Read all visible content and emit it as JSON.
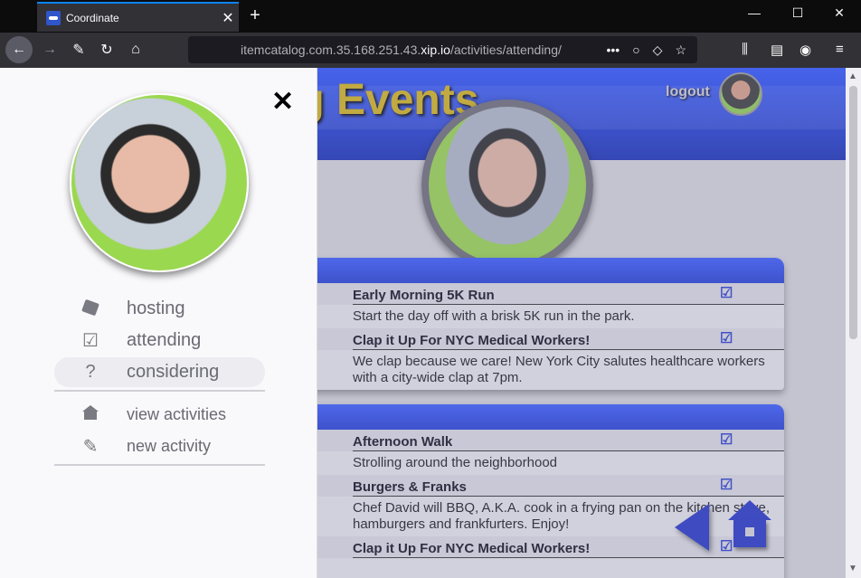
{
  "browser": {
    "tab_title": "Coordinate",
    "tab_close": "✕",
    "new_tab": "+",
    "url_host": "itemcatalog.com.35.168.251.43.",
    "url_domain": "xip.io",
    "url_path": "/activities/attending/",
    "window_controls": [
      "—",
      "☐",
      "✕"
    ]
  },
  "page": {
    "title": "ng Events",
    "logout_label": "logout"
  },
  "cards": [
    {
      "events": [
        {
          "title": "Early Morning 5K Run",
          "description": "Start the day off with a brisk 5K run in the park."
        },
        {
          "title": "Clap it Up For NYC Medical Workers!",
          "description": "We clap because we care! New York City salutes healthcare workers with a city-wide clap at 7pm."
        }
      ]
    },
    {
      "events": [
        {
          "title": "Afternoon Walk",
          "description": "Strolling around the neighborhood"
        },
        {
          "title": "Burgers & Franks",
          "description": "Chef David will BBQ, A.K.A. cook in a frying pan on the kitchen stove, hamburgers and frankfurters. Enjoy!"
        },
        {
          "title": "Clap it Up For NYC Medical Workers!",
          "description": ""
        }
      ]
    }
  ],
  "check_glyph": "☑",
  "sidebar": {
    "close_label": "✕",
    "items": [
      {
        "label": "hosting",
        "icon": "tag-icon"
      },
      {
        "label": "attending",
        "icon": "check-icon"
      },
      {
        "label": "considering",
        "icon": "question-icon"
      },
      {
        "label": "view activities",
        "icon": "house-icon"
      },
      {
        "label": "new activity",
        "icon": "pencil-icon"
      }
    ]
  },
  "colors": {
    "header_blue": "#2341d9",
    "title_gold": "#d3b51e",
    "fab_blue": "#2536c8"
  }
}
